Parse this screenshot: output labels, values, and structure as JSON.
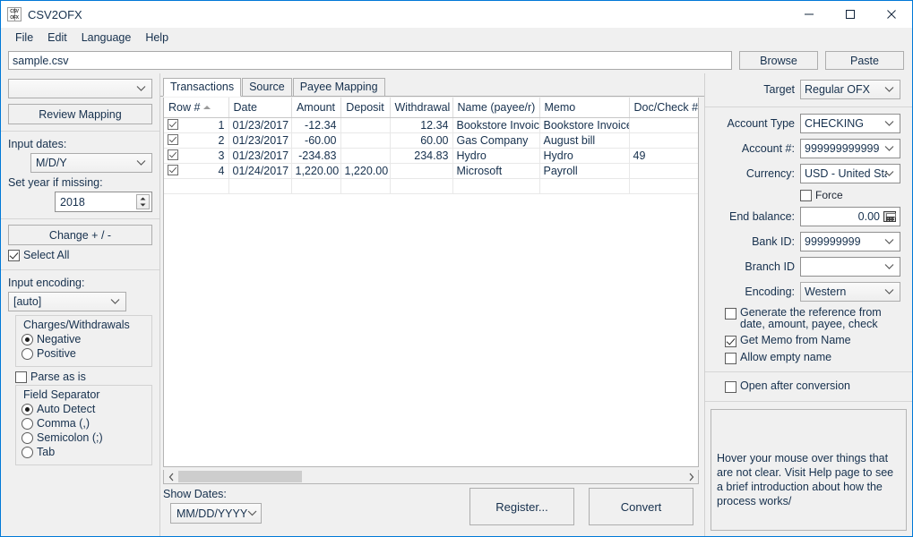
{
  "window": {
    "title": "CSV2OFX",
    "icon_top": "CSV",
    "icon_bottom": "OFX",
    "minimize": "minimize-icon",
    "maximize": "maximize-icon",
    "close": "close-icon"
  },
  "menubar": {
    "items": [
      "File",
      "Edit",
      "Language",
      "Help"
    ]
  },
  "pathrow": {
    "file_value": "sample.csv",
    "browse_label": "Browse",
    "paste_label": "Paste"
  },
  "left": {
    "mapping_combo_value": "",
    "review_mapping_label": "Review Mapping",
    "input_dates_label": "Input dates:",
    "input_dates_value": "M/D/Y",
    "set_year_label": "Set year if missing:",
    "set_year_value": "2018",
    "change_sign_label": "Change + / -",
    "select_all_label": "Select All",
    "select_all_checked": true,
    "input_encoding_label": "Input encoding:",
    "input_encoding_value": "[auto]",
    "charges_legend": "Charges/Withdrawals",
    "charges_options": [
      "Negative",
      "Positive"
    ],
    "charges_selected": "Negative",
    "parse_as_is_label": "Parse as is",
    "parse_as_is_checked": false,
    "field_sep_legend": "Field Separator",
    "field_sep_options": [
      "Auto Detect",
      "Comma (,)",
      "Semicolon (;)",
      "Tab"
    ],
    "field_sep_selected": "Auto Detect"
  },
  "center": {
    "tabs": [
      {
        "label": "Transactions",
        "active": true
      },
      {
        "label": "Source",
        "active": false
      },
      {
        "label": "Payee Mapping",
        "active": false
      }
    ],
    "table": {
      "columns": [
        "Row #",
        "Date",
        "Amount",
        "Deposit",
        "Withdrawal",
        "Name (payee/r)",
        "Memo",
        "Doc/Check #"
      ],
      "sort_column": "Row #",
      "sort_direction": "asc",
      "rows": [
        {
          "checked": true,
          "row": "1",
          "date": "01/23/2017",
          "amount": "-12.34",
          "deposit": "",
          "withdrawal": "12.34",
          "name": "Bookstore Invoice",
          "memo": "Bookstore Invoice",
          "doc": ""
        },
        {
          "checked": true,
          "row": "2",
          "date": "01/23/2017",
          "amount": "-60.00",
          "deposit": "",
          "withdrawal": "60.00",
          "name": "Gas Company",
          "memo": "August bill",
          "doc": ""
        },
        {
          "checked": true,
          "row": "3",
          "date": "01/23/2017",
          "amount": "-234.83",
          "deposit": "",
          "withdrawal": "234.83",
          "name": "Hydro",
          "memo": "Hydro",
          "doc": "49"
        },
        {
          "checked": true,
          "row": "4",
          "date": "01/24/2017",
          "amount": "1,220.00",
          "deposit": "1,220.00",
          "withdrawal": "",
          "name": "Microsoft",
          "memo": "Payroll",
          "doc": ""
        }
      ]
    },
    "show_dates_label": "Show Dates:",
    "show_dates_value": "MM/DD/YYYY",
    "register_label": "Register...",
    "convert_label": "Convert"
  },
  "right": {
    "target_label": "Target",
    "target_value": "Regular OFX",
    "account_type_label": "Account Type",
    "account_type_value": "CHECKING",
    "account_num_label": "Account #:",
    "account_num_value": "999999999999",
    "currency_label": "Currency:",
    "currency_value": "USD - United Sta",
    "force_label": "Force",
    "force_checked": false,
    "end_balance_label": "End balance:",
    "end_balance_value": "0.00",
    "bank_id_label": "Bank ID:",
    "bank_id_value": "999999999",
    "branch_id_label": "Branch ID",
    "branch_id_value": "",
    "encoding_label": "Encoding:",
    "encoding_value": "Western",
    "generate_ref_label": "Generate the reference from date, amount, payee, check",
    "generate_ref_checked": false,
    "get_memo_label": "Get Memo from Name",
    "get_memo_checked": true,
    "allow_empty_label": "Allow empty name",
    "allow_empty_checked": false,
    "open_after_label": "Open after conversion",
    "open_after_checked": false,
    "help_text": "Hover your mouse over things that are not clear. Visit Help page to see a brief introduction about how the process works/"
  },
  "colors": {
    "accent": "#0078d7",
    "text": "#16304d",
    "panel": "#f0f0f0"
  }
}
